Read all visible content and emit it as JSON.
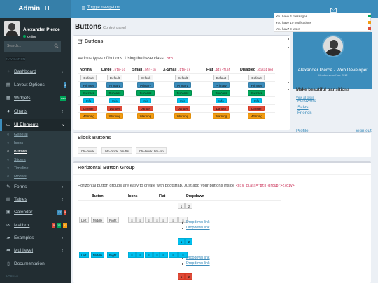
{
  "header": {
    "logo_bold": "Admin",
    "logo_rest": "LTE",
    "toggle_label": "Toggle navigation"
  },
  "user": {
    "name": "Alexander Pierce",
    "status": "Online"
  },
  "search": {
    "placeholder": "Search..."
  },
  "sidebar": {
    "header": "NAVIGATION",
    "items": [
      {
        "label": "Dashboard",
        "icon": "dashboard-icon"
      },
      {
        "label": "Layout Options",
        "icon": "files-icon",
        "badge": "4",
        "badge_color": "#3c8dbc"
      },
      {
        "label": "Widgets",
        "icon": "th-icon",
        "badge": "new",
        "badge_color": "#00a65a"
      },
      {
        "label": "Charts",
        "icon": "pie-chart-icon"
      },
      {
        "label": "UI Elements",
        "icon": "laptop-icon"
      },
      {
        "label": "Forms",
        "icon": "edit-icon"
      },
      {
        "label": "Tables",
        "icon": "table-icon"
      },
      {
        "label": "Calendar",
        "icon": "calendar-icon",
        "badges": [
          "17",
          "3"
        ],
        "badge_colors": [
          "#3c8dbc",
          "#dd4b39"
        ]
      },
      {
        "label": "Mailbox",
        "icon": "envelope-icon",
        "badges": [
          "5",
          "16",
          "12"
        ],
        "badge_colors": [
          "#dd4b39",
          "#00a65a",
          "#f39c12"
        ]
      },
      {
        "label": "Examples",
        "icon": "folder-icon"
      },
      {
        "label": "Multilevel",
        "icon": "share-icon"
      },
      {
        "label": "Documentation",
        "icon": "book-icon"
      }
    ],
    "ui_subitems": [
      "General",
      "Icons",
      "Buttons",
      "Sliders",
      "Timeline",
      "Modals"
    ],
    "labels_header": "LABELS"
  },
  "page": {
    "title": "Buttons",
    "subtitle": "Control panel"
  },
  "buttons_box": {
    "title": "Buttons",
    "desc": "Various types of buttons. Using the base class",
    "desc_code": ".btn",
    "columns": [
      {
        "label": "Normal",
        "code": ""
      },
      {
        "label": "Large",
        "code": ".btn-lg"
      },
      {
        "label": "Small",
        "code": ".btn-sm"
      },
      {
        "label": "X-Small",
        "code": ".btn-xs"
      },
      {
        "label": "Flat",
        "code": ".btn-flat"
      },
      {
        "label": "Disabled",
        "code": ".disabled"
      }
    ],
    "rows": [
      {
        "label": "Default",
        "style": "default"
      },
      {
        "label": "Primary",
        "style": "primary"
      },
      {
        "label": "Success",
        "style": "success"
      },
      {
        "label": "Info",
        "style": "info"
      },
      {
        "label": "Danger",
        "style": "danger"
      },
      {
        "label": "Warning",
        "style": "warning"
      }
    ]
  },
  "block_box": {
    "title": "Block Buttons",
    "buttons": [
      ".btn-block",
      ".btn-block .btn-flat",
      ".btn-block .btn-sm"
    ]
  },
  "group_box": {
    "title": "Horizontal Button Group",
    "desc": "Horizontal button groups are easy to create with bootstrap. Just add your buttons inside",
    "desc_code": "<div class=\"btn-group\"></div>",
    "headers": [
      "Button",
      "Icons",
      "Flat",
      "Dropdown"
    ],
    "group_buttons": [
      "Left",
      "Middle",
      "Right"
    ],
    "dropdown_numbers": [
      "1",
      "2"
    ],
    "dropdown_link": "Dropdown link"
  },
  "notifications": [
    {
      "text": "You have 4 messages",
      "color": "#00a65a"
    },
    {
      "text": "You have 10 notifications",
      "color": "#f39c12"
    },
    {
      "text": "You have 9 tasks",
      "color": "#dd4b39"
    }
  ],
  "user_panel": {
    "name": "Alexander Pierce - Web Developer",
    "since": "Member since Nov. 2012",
    "snippet": "Make beautiful transitions",
    "view_all": "View all tasks",
    "links": [
      "Followers",
      "Sales",
      "Friends"
    ],
    "profile": "Profile",
    "signout": "Sign out"
  }
}
